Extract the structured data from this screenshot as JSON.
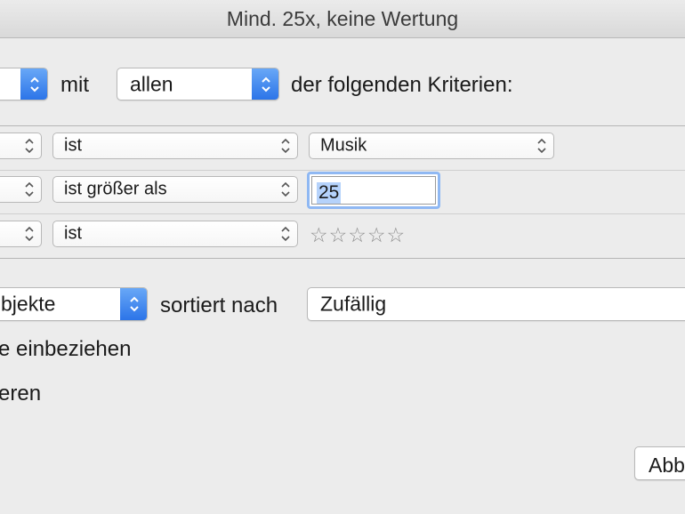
{
  "window": {
    "title": "Mind. 25x, keine Wertung"
  },
  "header_row": {
    "mit_label": "mit",
    "match_select_value": "allen",
    "criteria_label": "der folgenden Kriterien:"
  },
  "criteria": [
    {
      "operator": "ist",
      "value": "Musik"
    },
    {
      "operator": "ist größer als",
      "value": "25"
    },
    {
      "operator": "ist",
      "rating_stars": "☆☆☆☆☆"
    }
  ],
  "limit_row": {
    "unit_select_partial": "bjekte",
    "sorted_label": "sortiert nach",
    "sort_value": "Zufällig"
  },
  "options": [
    {
      "label_partial": "e einbeziehen"
    },
    {
      "label_partial": "eren"
    }
  ],
  "buttons": {
    "cancel_partial": "Abb"
  },
  "colors": {
    "accent_blue": "#2a73e8",
    "focus_ring": "#8fb8f3",
    "selection": "#b5d2fb",
    "window_bg": "#ececec"
  }
}
